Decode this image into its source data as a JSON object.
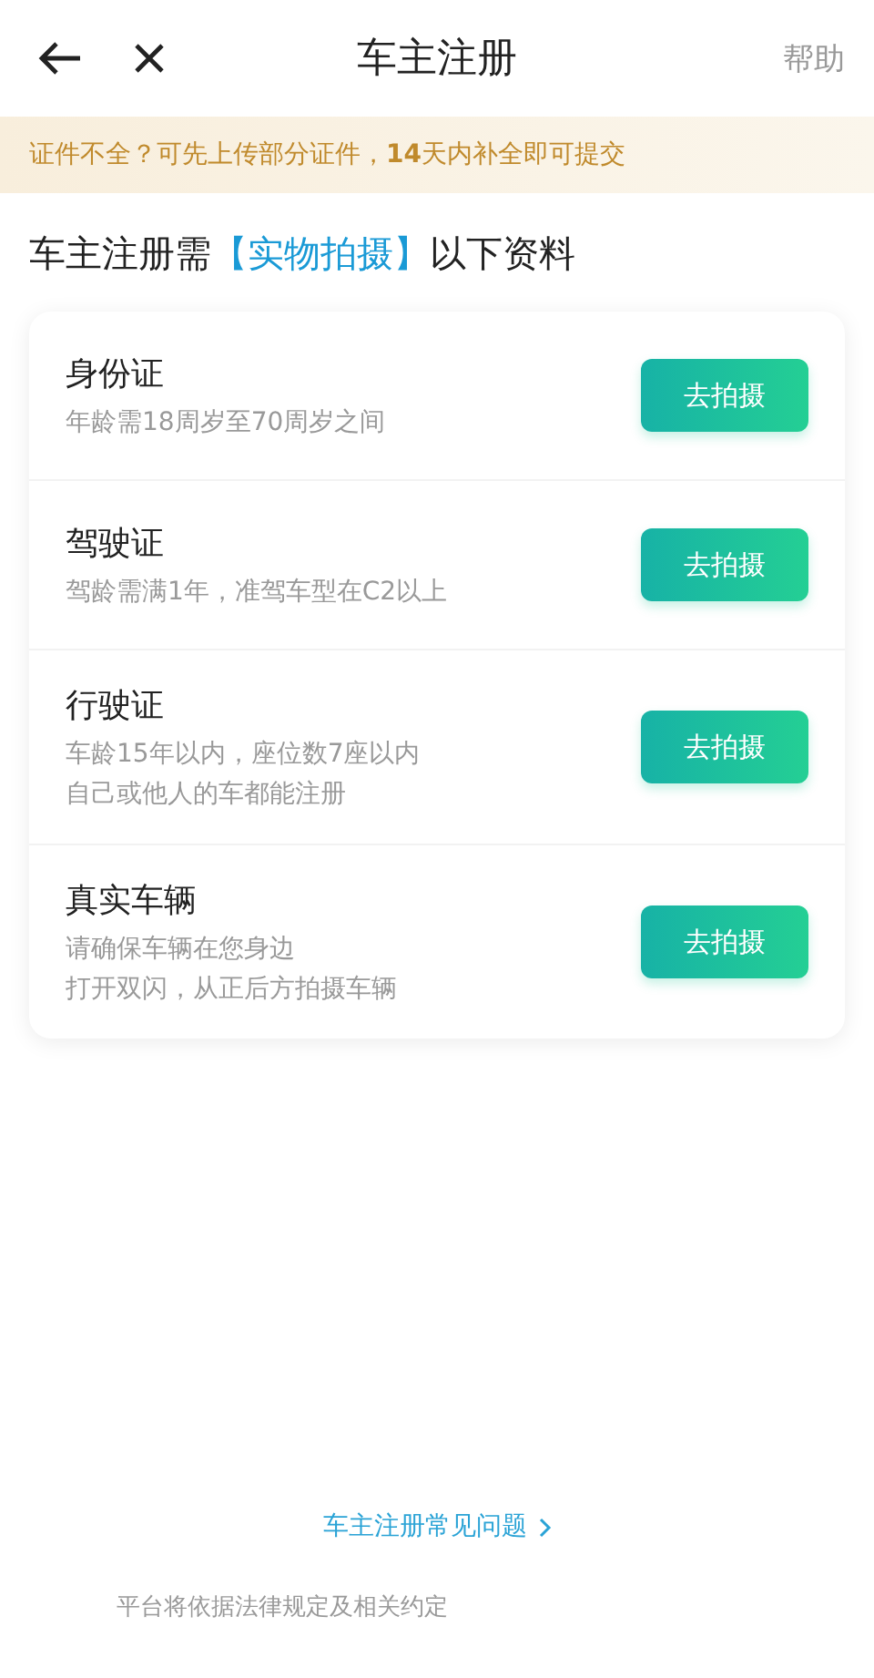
{
  "nav": {
    "title": "车主注册",
    "help": "帮助"
  },
  "notice": "证件不全？可先上传部分证件，**14**天内补全即可提交",
  "heading": {
    "before": "车主注册需",
    "highlight": "【实物拍摄】",
    "after": "以下资料"
  },
  "documents": [
    {
      "title": "身份证",
      "notes": [
        "年龄需18周岁至70周岁之间"
      ],
      "button": "去拍摄"
    },
    {
      "title": "驾驶证",
      "notes": [
        "驾龄需满1年，准驾车型在C2以上"
      ],
      "button": "去拍摄"
    },
    {
      "title": "行驶证",
      "notes": [
        "车龄15年以内，座位数7座以内",
        "自己或他人的车都能注册"
      ],
      "button": "去拍摄"
    },
    {
      "title": "真实车辆",
      "notes": [
        "请确保车辆在您身边",
        "打开双闪，从正后方拍摄车辆"
      ],
      "button": "去拍摄"
    }
  ],
  "faq_link": "车主注册常见问题",
  "footer": "平台将依据法律规定及相关约定"
}
